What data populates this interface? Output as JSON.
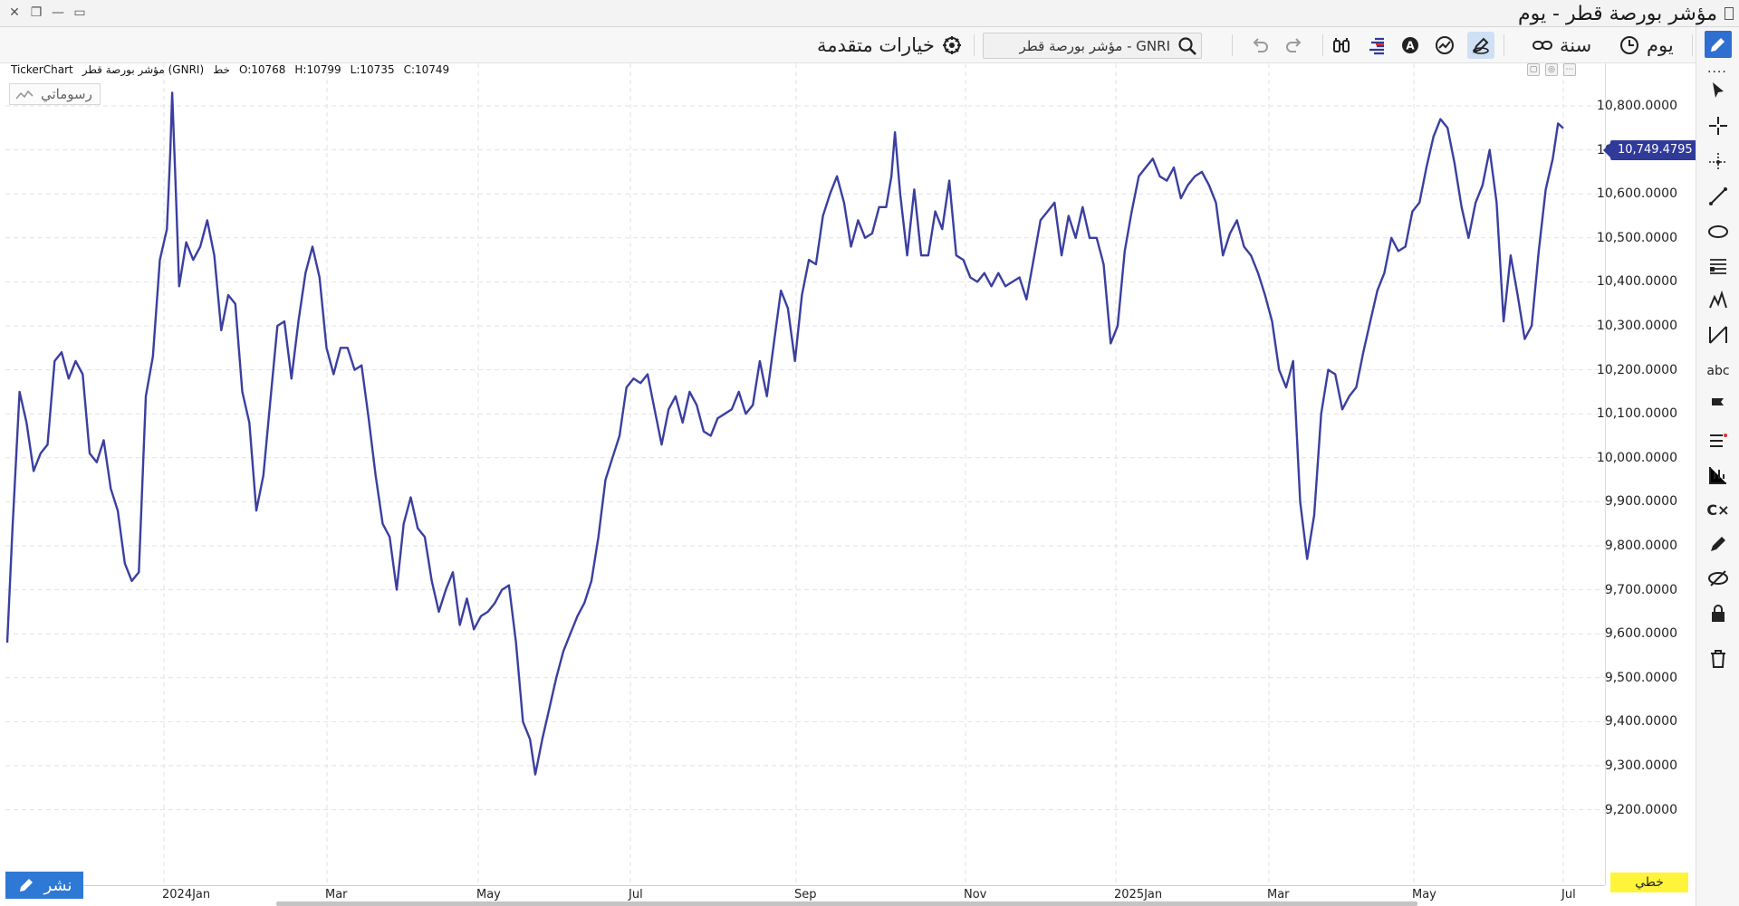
{
  "window": {
    "title": "مؤشر بورصة قطر - يوم"
  },
  "toolbar": {
    "period_label": "يوم",
    "range_label": "سنة",
    "advanced_options_label": "خيارات متقدمة",
    "search": {
      "value": "GNRI - مؤشر بورصة قطر",
      "placeholder": ""
    }
  },
  "chart_header": {
    "source": "TickerChart",
    "name": "مؤشر بورصة قطر (GNRI)",
    "style_label": "خط",
    "open": "O:10768",
    "high": "H:10799",
    "low": "L:10735",
    "close": "C:10749",
    "drawings_label": "رسوماتي"
  },
  "y_axis": {
    "ticks": [
      "10,800.0000",
      "10,700.0000",
      "10,600.0000",
      "10,500.0000",
      "10,400.0000",
      "10,300.0000",
      "10,200.0000",
      "10,100.0000",
      "10,000.0000",
      "9,900.0000",
      "9,800.0000",
      "9,700.0000",
      "9,600.0000",
      "9,500.0000",
      "9,400.0000",
      "9,300.0000",
      "9,200.0000"
    ],
    "current_price": "10,749.4795"
  },
  "x_axis": {
    "labels": [
      "2024Jan",
      "Mar",
      "May",
      "Jul",
      "Sep",
      "Nov",
      "2025Jan",
      "Mar",
      "May",
      "Jul"
    ]
  },
  "footer": {
    "publish_label": "نشر",
    "scale_label": "خطي"
  },
  "colors": {
    "line": "#3a3fa0",
    "price_badge": "#2f3a99",
    "publish_button": "#2e79d6",
    "scale_highlight": "#fff43a"
  },
  "chart_data": {
    "type": "line",
    "series": [
      {
        "values": [
          [
            0,
            9580
          ],
          [
            6,
            9840
          ],
          [
            14,
            10150
          ],
          [
            22,
            10080
          ],
          [
            30,
            9970
          ],
          [
            38,
            10010
          ],
          [
            46,
            10030
          ],
          [
            54,
            10220
          ],
          [
            62,
            10240
          ],
          [
            70,
            10180
          ],
          [
            78,
            10220
          ],
          [
            86,
            10190
          ],
          [
            94,
            10010
          ],
          [
            102,
            9990
          ],
          [
            110,
            10040
          ],
          [
            118,
            9930
          ],
          [
            126,
            9880
          ],
          [
            134,
            9760
          ],
          [
            142,
            9720
          ],
          [
            150,
            9740
          ],
          [
            158,
            10140
          ],
          [
            166,
            10230
          ],
          [
            174,
            10450
          ],
          [
            182,
            10520
          ],
          [
            186,
            10700
          ],
          [
            188,
            10830
          ],
          [
            192,
            10620
          ],
          [
            196,
            10390
          ],
          [
            204,
            10490
          ],
          [
            212,
            10450
          ],
          [
            220,
            10480
          ],
          [
            228,
            10540
          ],
          [
            236,
            10460
          ],
          [
            244,
            10290
          ],
          [
            252,
            10370
          ],
          [
            260,
            10350
          ],
          [
            268,
            10150
          ],
          [
            276,
            10080
          ],
          [
            284,
            9880
          ],
          [
            292,
            9960
          ],
          [
            300,
            10130
          ],
          [
            308,
            10300
          ],
          [
            316,
            10310
          ],
          [
            324,
            10180
          ],
          [
            332,
            10310
          ],
          [
            340,
            10420
          ],
          [
            348,
            10480
          ],
          [
            356,
            10410
          ],
          [
            364,
            10250
          ],
          [
            372,
            10190
          ],
          [
            380,
            10250
          ],
          [
            388,
            10250
          ],
          [
            396,
            10200
          ],
          [
            404,
            10210
          ],
          [
            412,
            10090
          ],
          [
            420,
            9960
          ],
          [
            428,
            9850
          ],
          [
            436,
            9820
          ],
          [
            444,
            9700
          ],
          [
            452,
            9850
          ],
          [
            460,
            9910
          ],
          [
            468,
            9840
          ],
          [
            476,
            9820
          ],
          [
            484,
            9720
          ],
          [
            492,
            9650
          ],
          [
            500,
            9700
          ],
          [
            508,
            9740
          ],
          [
            516,
            9620
          ],
          [
            524,
            9680
          ],
          [
            532,
            9610
          ],
          [
            540,
            9640
          ],
          [
            548,
            9650
          ],
          [
            556,
            9670
          ],
          [
            564,
            9700
          ],
          [
            572,
            9710
          ],
          [
            580,
            9580
          ],
          [
            588,
            9400
          ],
          [
            596,
            9360
          ],
          [
            602,
            9280
          ],
          [
            610,
            9360
          ],
          [
            618,
            9430
          ],
          [
            626,
            9500
          ],
          [
            634,
            9560
          ],
          [
            642,
            9600
          ],
          [
            650,
            9640
          ],
          [
            658,
            9670
          ],
          [
            666,
            9720
          ],
          [
            674,
            9820
          ],
          [
            682,
            9950
          ],
          [
            690,
            10000
          ],
          [
            698,
            10050
          ],
          [
            706,
            10160
          ],
          [
            714,
            10180
          ],
          [
            722,
            10170
          ],
          [
            730,
            10190
          ],
          [
            738,
            10110
          ],
          [
            746,
            10030
          ],
          [
            754,
            10110
          ],
          [
            762,
            10140
          ],
          [
            770,
            10080
          ],
          [
            778,
            10150
          ],
          [
            786,
            10120
          ],
          [
            794,
            10060
          ],
          [
            802,
            10050
          ],
          [
            810,
            10090
          ],
          [
            818,
            10100
          ],
          [
            826,
            10110
          ],
          [
            834,
            10150
          ],
          [
            842,
            10100
          ],
          [
            850,
            10120
          ],
          [
            858,
            10220
          ],
          [
            866,
            10140
          ],
          [
            874,
            10260
          ],
          [
            882,
            10380
          ],
          [
            890,
            10340
          ],
          [
            898,
            10220
          ],
          [
            906,
            10370
          ],
          [
            914,
            10450
          ],
          [
            922,
            10440
          ],
          [
            930,
            10550
          ],
          [
            938,
            10600
          ],
          [
            946,
            10640
          ],
          [
            954,
            10580
          ],
          [
            962,
            10480
          ],
          [
            970,
            10540
          ],
          [
            978,
            10500
          ],
          [
            986,
            10510
          ],
          [
            994,
            10570
          ],
          [
            1002,
            10570
          ],
          [
            1008,
            10640
          ],
          [
            1012,
            10740
          ],
          [
            1018,
            10600
          ],
          [
            1026,
            10460
          ],
          [
            1034,
            10610
          ],
          [
            1042,
            10460
          ],
          [
            1050,
            10460
          ],
          [
            1058,
            10560
          ],
          [
            1066,
            10520
          ],
          [
            1074,
            10630
          ],
          [
            1082,
            10460
          ],
          [
            1090,
            10450
          ],
          [
            1098,
            10410
          ],
          [
            1106,
            10400
          ],
          [
            1114,
            10420
          ],
          [
            1122,
            10390
          ],
          [
            1130,
            10420
          ],
          [
            1138,
            10390
          ],
          [
            1146,
            10400
          ],
          [
            1154,
            10410
          ],
          [
            1162,
            10360
          ],
          [
            1170,
            10450
          ],
          [
            1178,
            10540
          ],
          [
            1186,
            10560
          ],
          [
            1194,
            10580
          ],
          [
            1202,
            10460
          ],
          [
            1210,
            10550
          ],
          [
            1218,
            10500
          ],
          [
            1226,
            10570
          ],
          [
            1234,
            10500
          ],
          [
            1242,
            10500
          ],
          [
            1250,
            10440
          ],
          [
            1258,
            10260
          ],
          [
            1266,
            10300
          ],
          [
            1274,
            10470
          ],
          [
            1282,
            10560
          ],
          [
            1290,
            10640
          ],
          [
            1298,
            10660
          ],
          [
            1306,
            10680
          ],
          [
            1314,
            10640
          ],
          [
            1322,
            10630
          ],
          [
            1330,
            10660
          ],
          [
            1338,
            10590
          ],
          [
            1346,
            10620
          ],
          [
            1354,
            10640
          ],
          [
            1362,
            10650
          ],
          [
            1370,
            10620
          ],
          [
            1378,
            10580
          ],
          [
            1386,
            10460
          ],
          [
            1394,
            10510
          ],
          [
            1402,
            10540
          ],
          [
            1410,
            10480
          ],
          [
            1418,
            10460
          ],
          [
            1426,
            10420
          ],
          [
            1434,
            10370
          ],
          [
            1442,
            10310
          ],
          [
            1450,
            10200
          ],
          [
            1458,
            10160
          ],
          [
            1466,
            10220
          ],
          [
            1474,
            9900
          ],
          [
            1482,
            9770
          ],
          [
            1490,
            9870
          ],
          [
            1498,
            10100
          ],
          [
            1506,
            10200
          ],
          [
            1514,
            10190
          ],
          [
            1522,
            10110
          ],
          [
            1530,
            10140
          ],
          [
            1538,
            10160
          ],
          [
            1546,
            10240
          ],
          [
            1554,
            10310
          ],
          [
            1562,
            10380
          ],
          [
            1570,
            10420
          ],
          [
            1578,
            10500
          ],
          [
            1586,
            10470
          ],
          [
            1594,
            10480
          ],
          [
            1602,
            10560
          ],
          [
            1610,
            10580
          ],
          [
            1618,
            10660
          ],
          [
            1626,
            10730
          ],
          [
            1634,
            10770
          ],
          [
            1642,
            10750
          ],
          [
            1650,
            10670
          ],
          [
            1658,
            10570
          ],
          [
            1666,
            10500
          ],
          [
            1674,
            10580
          ],
          [
            1682,
            10620
          ],
          [
            1690,
            10700
          ],
          [
            1698,
            10580
          ],
          [
            1706,
            10310
          ],
          [
            1714,
            10460
          ],
          [
            1722,
            10370
          ],
          [
            1730,
            10270
          ],
          [
            1738,
            10300
          ],
          [
            1746,
            10470
          ],
          [
            1754,
            10610
          ],
          [
            1762,
            10680
          ],
          [
            1768,
            10760
          ],
          [
            1774,
            10749
          ]
        ]
      }
    ],
    "ylim": [
      9100,
      10900
    ],
    "grid": true
  }
}
